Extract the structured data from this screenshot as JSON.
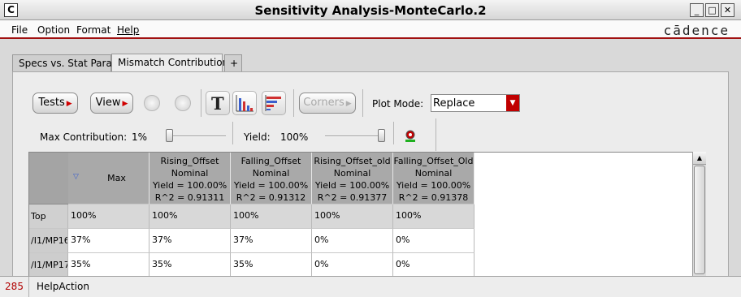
{
  "window": {
    "icon_letter": "C",
    "title": "Sensitivity Analysis-MonteCarlo.2",
    "controls": [
      "_",
      "□",
      "✕"
    ]
  },
  "menu": {
    "items": [
      "File",
      "Option",
      "Format",
      "Help"
    ],
    "brand": "cādence"
  },
  "tabs": [
    {
      "label": "Specs vs. Stat Param"
    },
    {
      "label": "Mismatch Contribution"
    },
    {
      "label": "+"
    }
  ],
  "toolbar": {
    "tests_label": "Tests",
    "view_label": "View",
    "corners_label": "Corners",
    "plot_mode_label": "Plot Mode:",
    "plot_mode_value": "Replace",
    "accent_color": "#c00000"
  },
  "controls": {
    "max_contribution_label": "Max Contribution:",
    "max_contribution_value": "1%",
    "max_contribution_level": 0.0,
    "yield_label": "Yield:",
    "yield_value": "100%",
    "yield_level": 1.0
  },
  "table": {
    "corner_header": "Max",
    "columns": [
      {
        "name": "Rising_Offset",
        "line2": "Nominal",
        "line3": "Yield = 100.00%",
        "line4": "R^2 = 0.91311"
      },
      {
        "name": "Falling_Offset",
        "line2": "Nominal",
        "line3": "Yield = 100.00%",
        "line4": "R^2 = 0.91312"
      },
      {
        "name": "Rising_Offset_old",
        "line2": "Nominal",
        "line3": "Yield = 100.00%",
        "line4": "R^2 = 0.91377"
      },
      {
        "name": "Falling_Offset_Old",
        "line2": "Nominal",
        "line3": "Yield = 100.00%",
        "line4": "R^2 = 0.91378"
      }
    ],
    "rows": [
      {
        "label": "Top",
        "max": "100%",
        "cells": [
          "100%",
          "100%",
          "100%",
          "100%"
        ]
      },
      {
        "label": "/I1/MP16",
        "max": "37%",
        "cells": [
          "37%",
          "37%",
          "0%",
          "0%"
        ]
      },
      {
        "label": "/I1/MP17",
        "max": "35%",
        "cells": [
          "35%",
          "35%",
          "0%",
          "0%"
        ]
      }
    ]
  },
  "status": {
    "line_number": "285",
    "message": "HelpAction"
  }
}
